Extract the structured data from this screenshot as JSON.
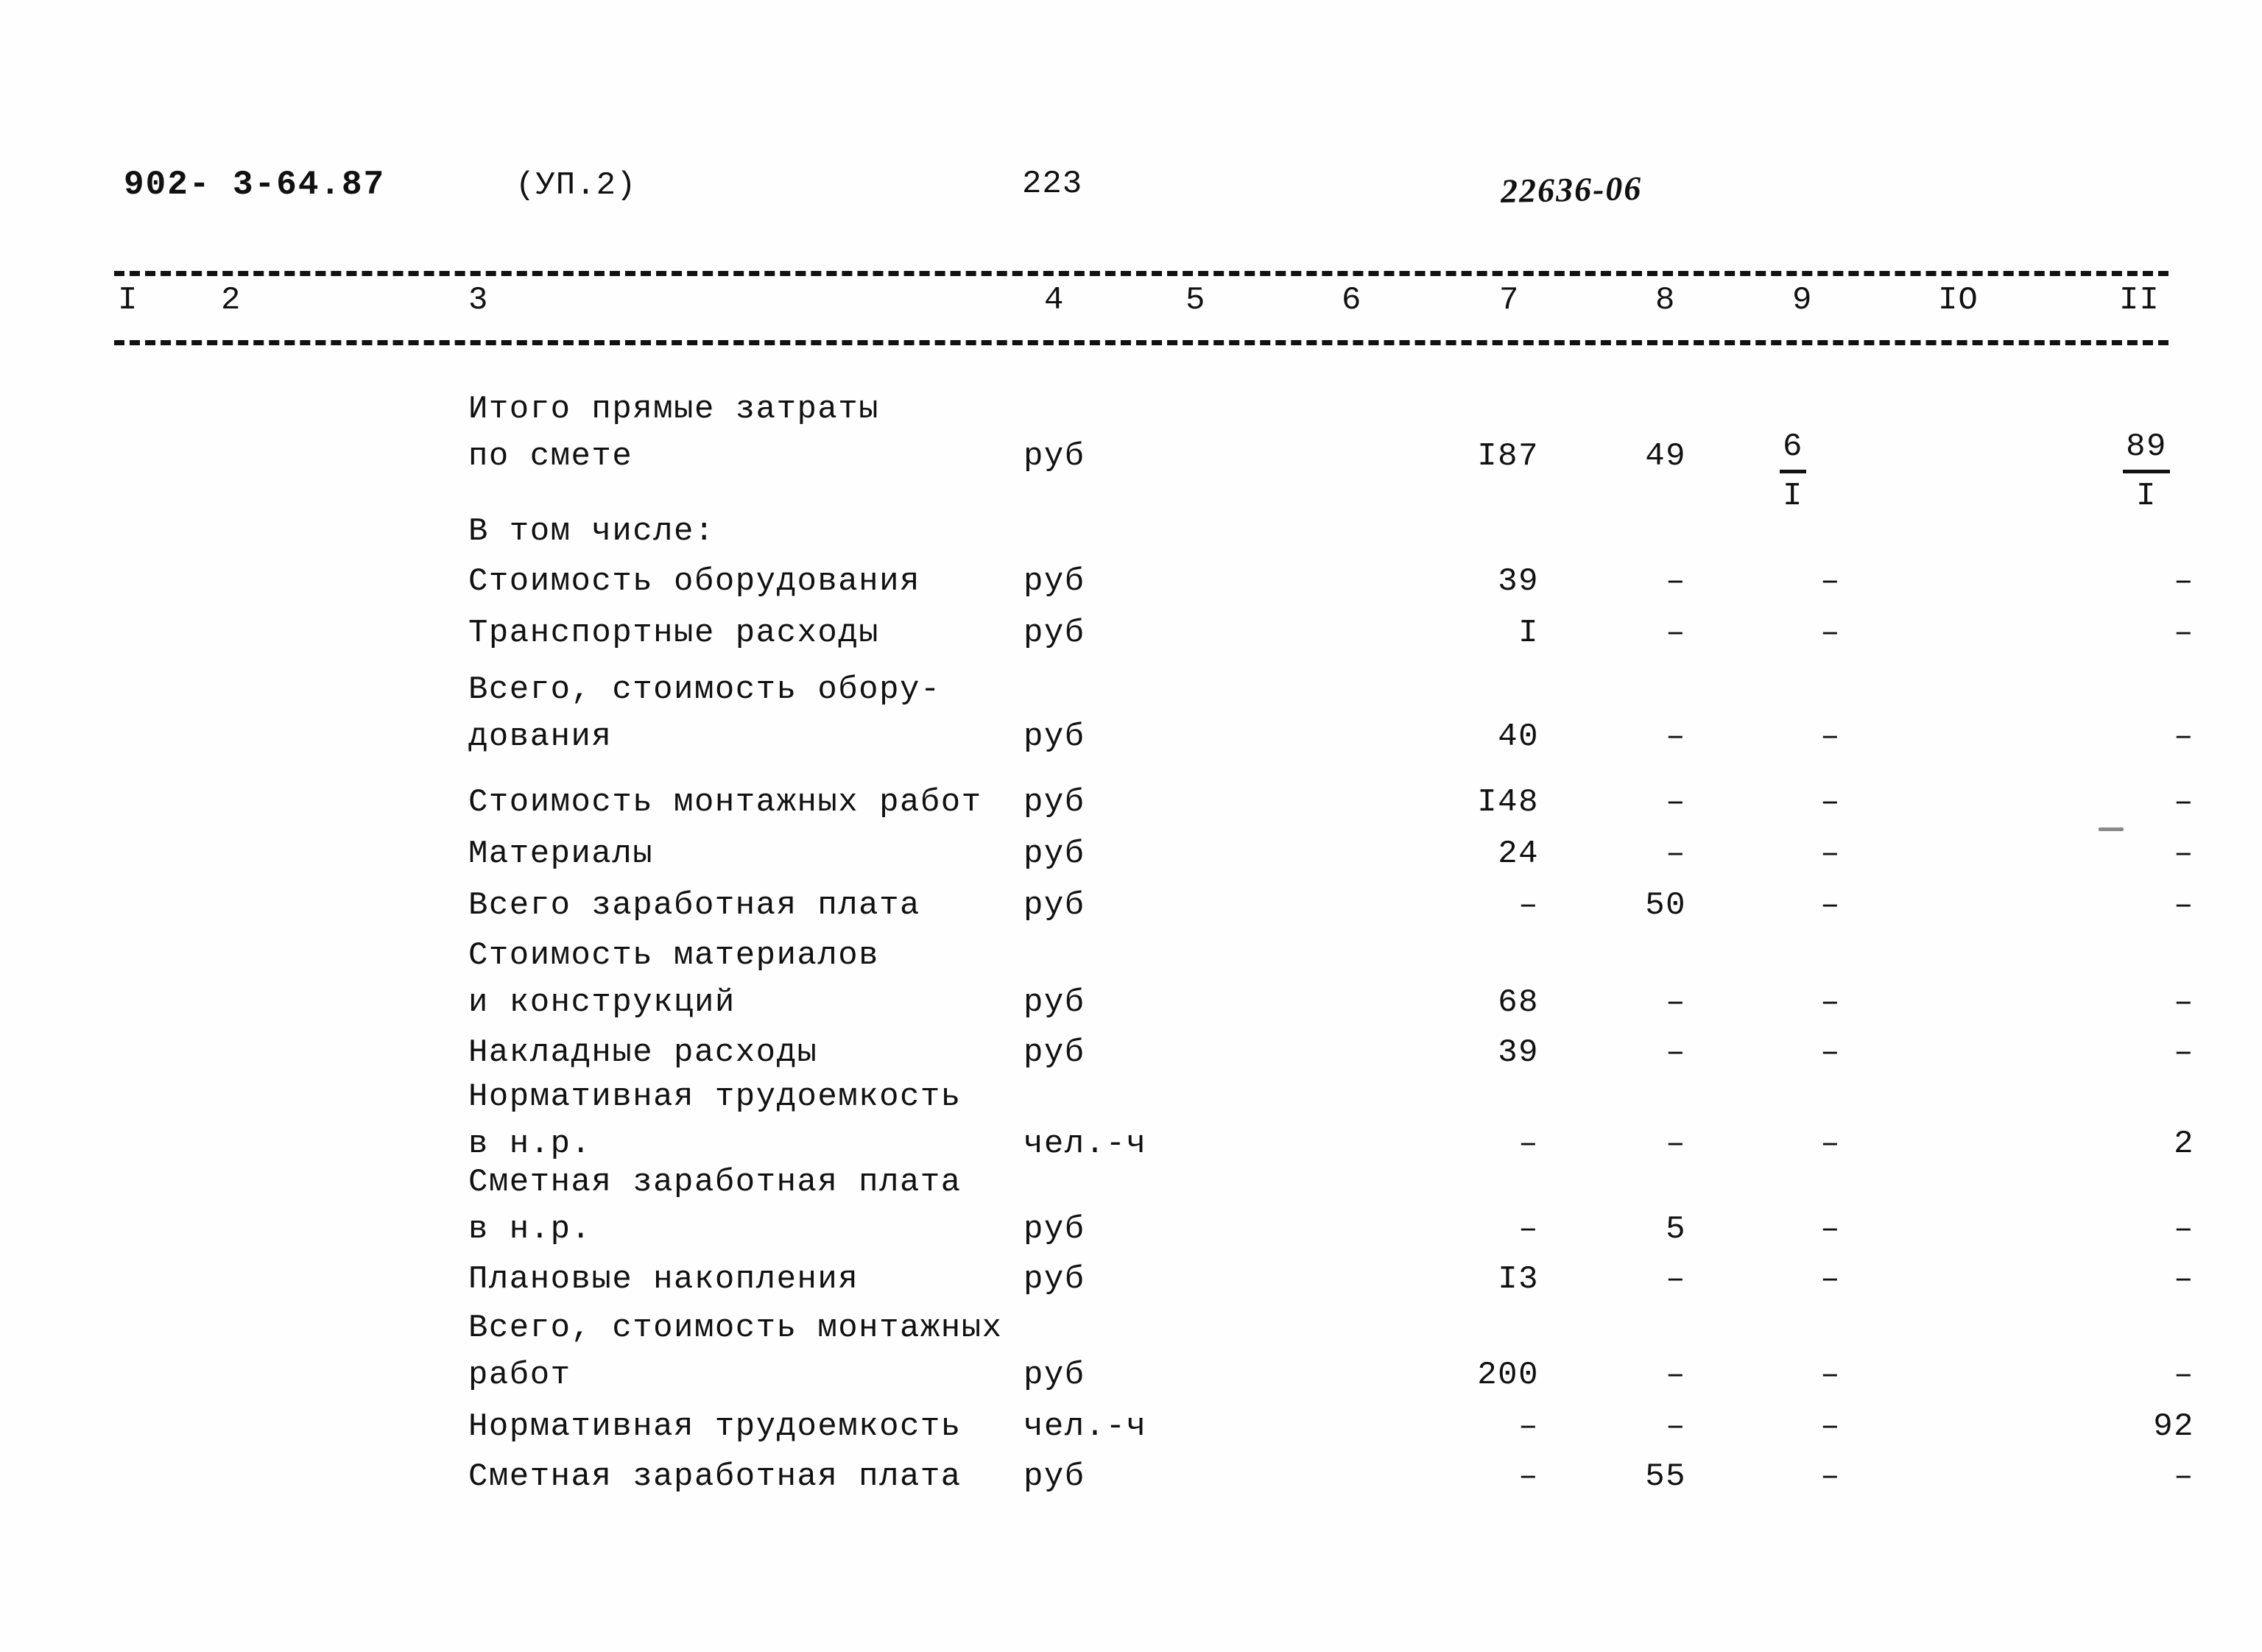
{
  "header": {
    "document_number": "902- 3-64.87",
    "sheet_label": "(УП.2)",
    "page_number": "223",
    "archive_code": "22636-06"
  },
  "table": {
    "column_headers": [
      "I",
      "2",
      "3",
      "4",
      "5",
      "6",
      "7",
      "8",
      "9",
      "IO",
      "II"
    ],
    "rows": [
      {
        "name_line1": "Итого прямые затраты",
        "name_line2": "по смете",
        "unit": "руб",
        "c7": "I87",
        "c8": "49",
        "c9_num": "6",
        "c9_den": "I",
        "c10": "",
        "c11_num": "89",
        "c11_den": "I"
      },
      {
        "name_line1": "В том числе:",
        "name_line2": "",
        "unit": "",
        "c7": "",
        "c8": "",
        "c9": "",
        "c10": "",
        "c11": ""
      },
      {
        "name_line1": "Стоимость оборудования",
        "name_line2": "",
        "unit": "руб",
        "c7": "39",
        "c8": "–",
        "c9": "–",
        "c10": "",
        "c11": "–"
      },
      {
        "name_line1": "Транспортные расходы",
        "name_line2": "",
        "unit": "руб",
        "c7": "I",
        "c8": "–",
        "c9": "–",
        "c10": "",
        "c11": "–"
      },
      {
        "name_line1": "Всего, стоимость обору-",
        "name_line2": "дования",
        "unit": "руб",
        "c7": "40",
        "c8": "–",
        "c9": "–",
        "c10": "",
        "c11": "–"
      },
      {
        "name_line1": "Стоимость монтажных работ",
        "name_line2": "",
        "unit": "руб",
        "c7": "I48",
        "c8": "–",
        "c9": "–",
        "c10": "",
        "c11": "–"
      },
      {
        "name_line1": "Материалы",
        "name_line2": "",
        "unit": "руб",
        "c7": "24",
        "c8": "–",
        "c9": "–",
        "c10": "",
        "c11": "–"
      },
      {
        "name_line1": "Всего заработная плата",
        "name_line2": "",
        "unit": "руб",
        "c7": "–",
        "c8": "50",
        "c9": "–",
        "c10": "",
        "c11": "–"
      },
      {
        "name_line1": "Стоимость материалов",
        "name_line2": "и конструкций",
        "unit": "руб",
        "c7": "68",
        "c8": "–",
        "c9": "–",
        "c10": "",
        "c11": "–"
      },
      {
        "name_line1": "Накладные расходы",
        "name_line2": "",
        "unit": "руб",
        "c7": "39",
        "c8": "–",
        "c9": "–",
        "c10": "",
        "c11": "–"
      },
      {
        "name_line1": "Нормативная трудоемкость",
        "name_line2": "в н.р.",
        "unit": "чел.-ч",
        "c7": "–",
        "c8": "–",
        "c9": "–",
        "c10": "",
        "c11": "2"
      },
      {
        "name_line1": "Сметная заработная плата",
        "name_line2": "в н.р.",
        "unit": "руб",
        "c7": "–",
        "c8": "5",
        "c9": "–",
        "c10": "",
        "c11": "–"
      },
      {
        "name_line1": "Плановые накопления",
        "name_line2": "",
        "unit": "руб",
        "c7": "I3",
        "c8": "–",
        "c9": "–",
        "c10": "",
        "c11": "–"
      },
      {
        "name_line1": "Всего, стоимость монтажных",
        "name_line2": "работ",
        "unit": "руб",
        "c7": "200",
        "c8": "–",
        "c9": "–",
        "c10": "",
        "c11": "–"
      },
      {
        "name_line1": "Нормативная трудоемкость",
        "name_line2": "",
        "unit": "чел.-ч",
        "c7": "–",
        "c8": "–",
        "c9": "–",
        "c10": "",
        "c11": "92"
      },
      {
        "name_line1": "Сметная заработная плата",
        "name_line2": "",
        "unit": "руб",
        "c7": "–",
        "c8": "55",
        "c9": "–",
        "c10": "",
        "c11": "–"
      }
    ]
  }
}
